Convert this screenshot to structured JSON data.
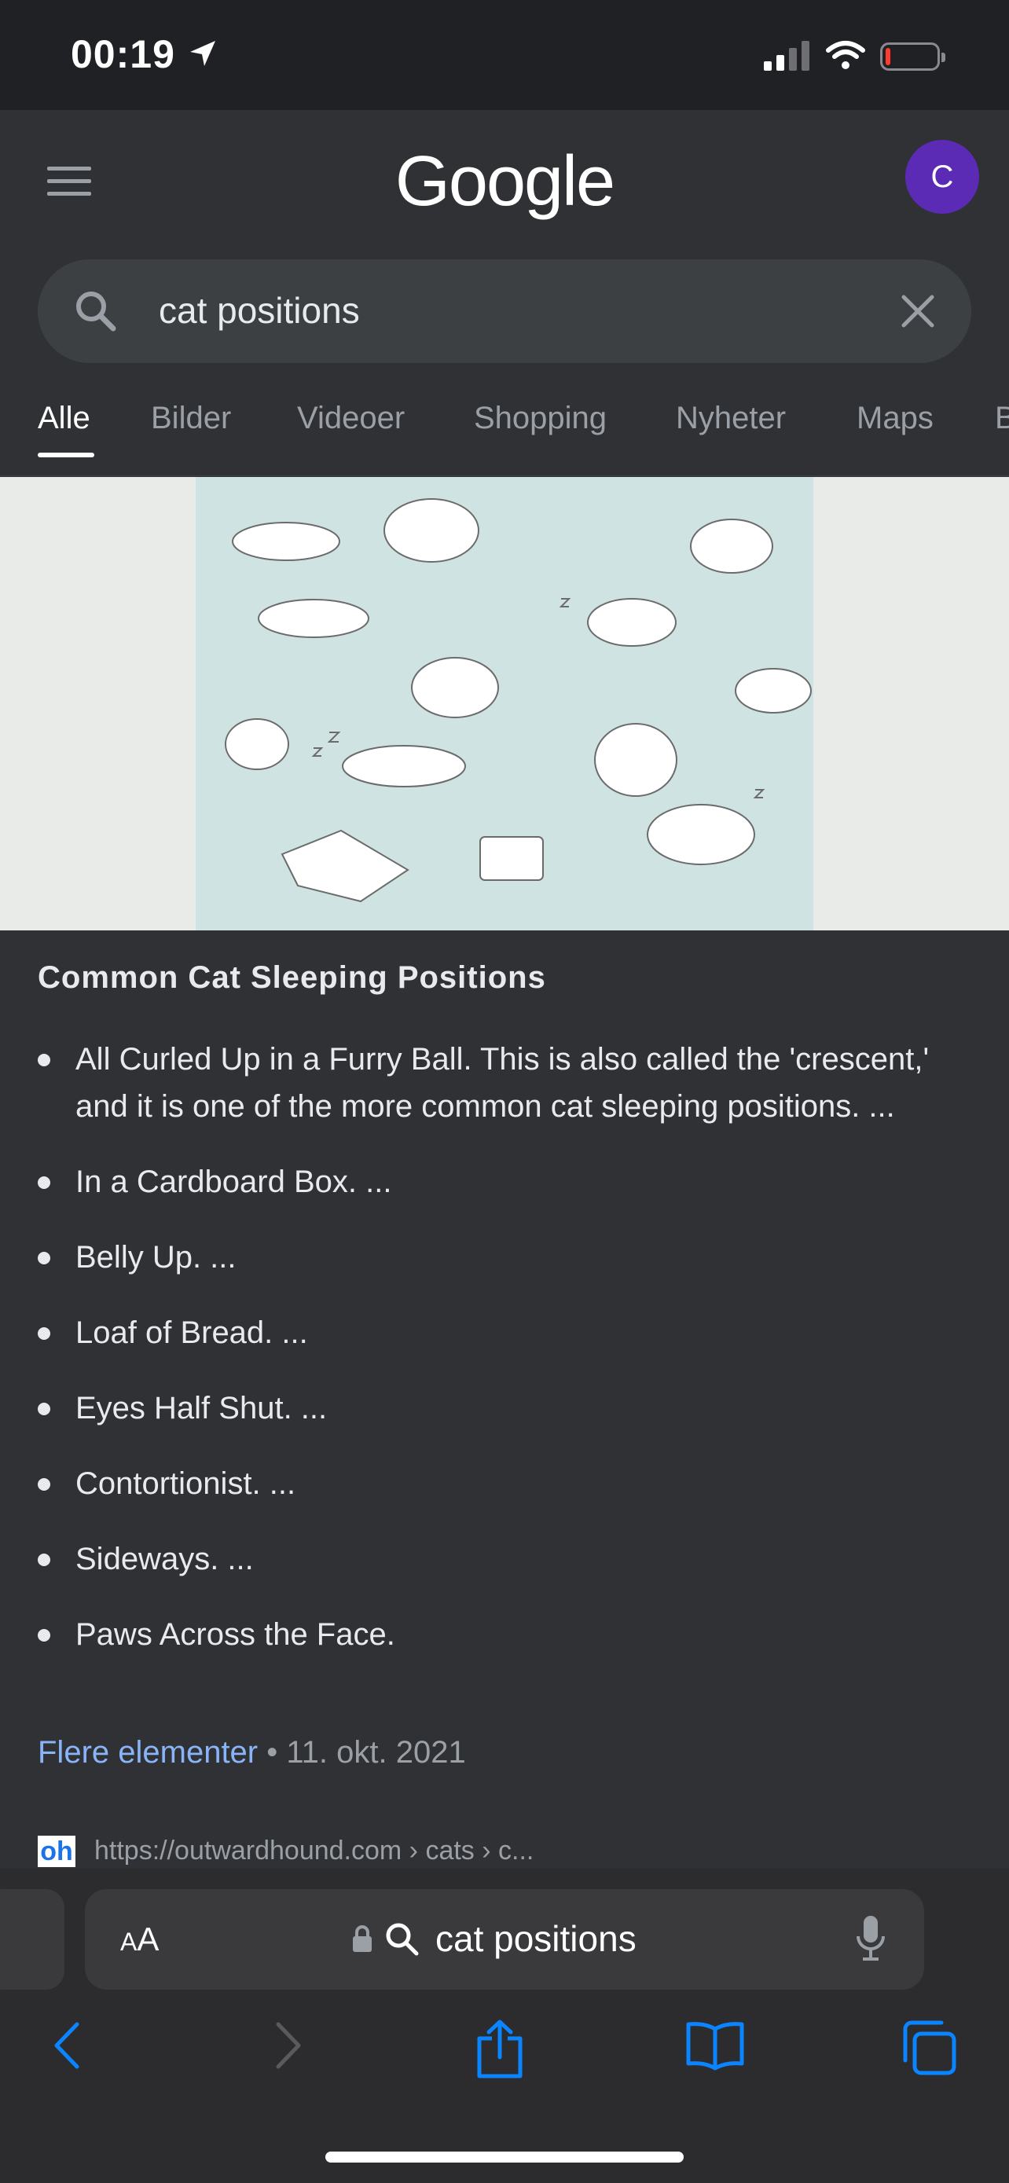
{
  "status_bar": {
    "time": "00:19",
    "icons": [
      "location-arrow-icon",
      "signal-icon",
      "wifi-icon",
      "battery-low-icon"
    ]
  },
  "header": {
    "logo": "Google",
    "avatar_letter": "C",
    "menu_icon": "hamburger-menu-icon"
  },
  "search": {
    "query": "cat positions",
    "search_icon": "search-icon",
    "clear_icon": "close-icon"
  },
  "tabs": [
    {
      "label": "Alle",
      "active": true
    },
    {
      "label": "Bilder",
      "active": false
    },
    {
      "label": "Videoer",
      "active": false
    },
    {
      "label": "Shopping",
      "active": false
    },
    {
      "label": "Nyheter",
      "active": false
    },
    {
      "label": "Maps",
      "active": false
    },
    {
      "label": "B",
      "active": false
    }
  ],
  "result": {
    "title": "Common Cat Sleeping Positions",
    "items": [
      "All Curled Up in a Furry Ball. This is also called the 'crescent,' and it is one of the more common cat sleeping positions. ...",
      "In a Cardboard Box. ...",
      "Belly Up. ...",
      "Loaf of Bread. ...",
      "Eyes Half Shut. ...",
      "Contortionist. ...",
      "Sideways. ...",
      "Paws Across the Face."
    ],
    "more_link": "Flere elementer",
    "separator": "•",
    "date": "11. okt. 2021",
    "source_favicon": "oh",
    "source_url": "https://outwardhound.com › cats › c..."
  },
  "browser": {
    "aa_label_small": "A",
    "aa_label_large": "A",
    "address": "cat positions",
    "toolbar_icons": [
      "back-icon",
      "forward-icon",
      "share-icon",
      "bookmarks-icon",
      "tabs-icon"
    ]
  },
  "colors": {
    "background": "#303134",
    "status_bar": "#202124",
    "link": "#8ab4f8",
    "avatar": "#5b2bb5",
    "accent_blue": "#0a84ff"
  }
}
